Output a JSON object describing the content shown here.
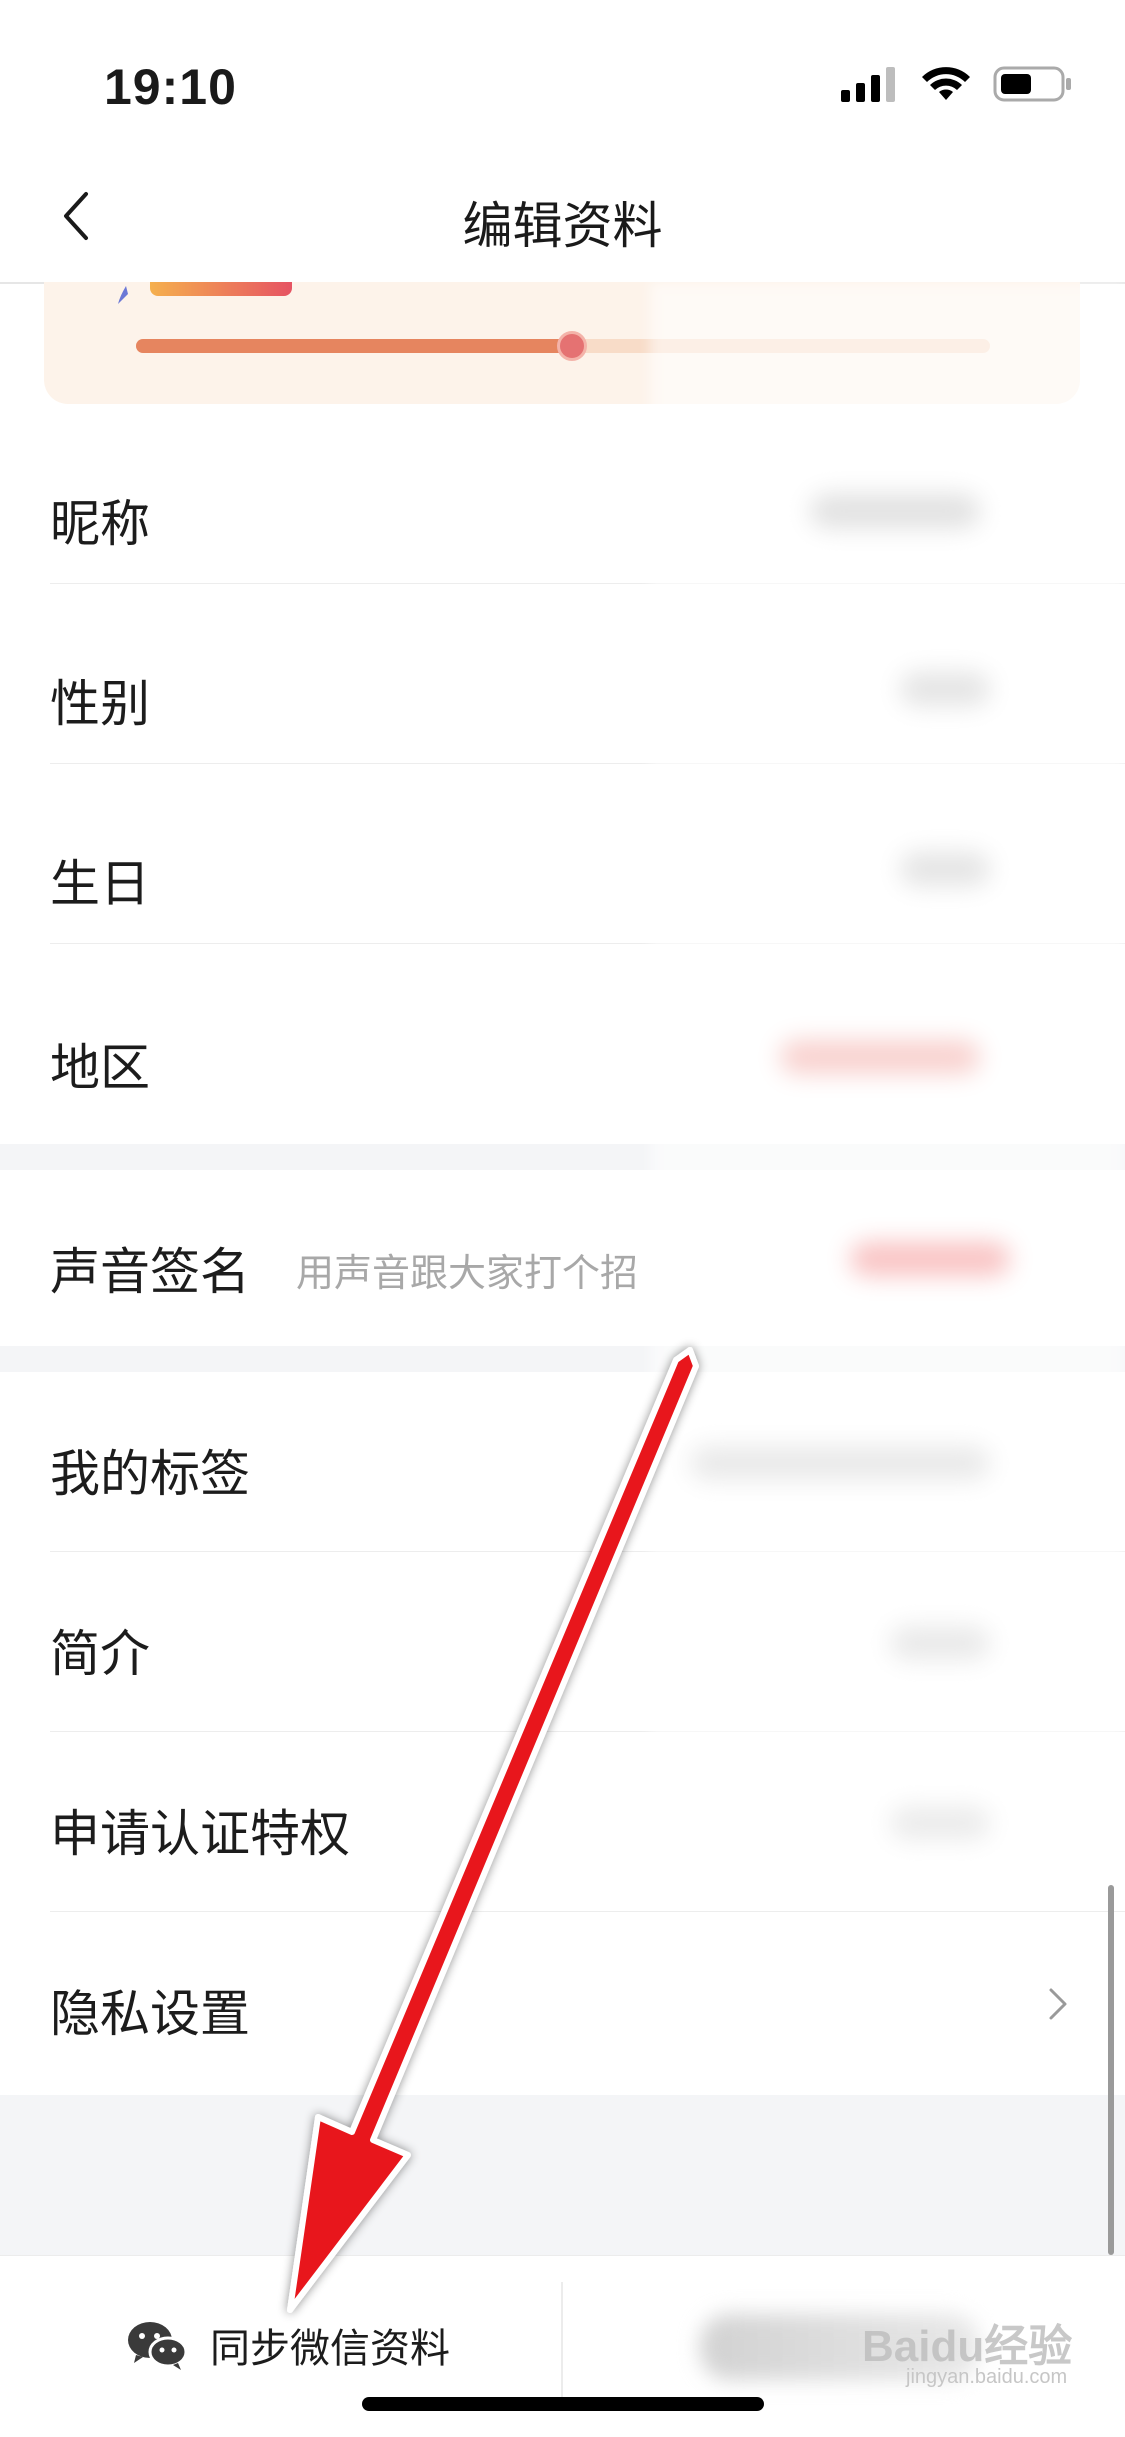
{
  "status": {
    "time": "19:10"
  },
  "nav": {
    "title": "编辑资料"
  },
  "profile": {
    "completion_fraction": 0.51
  },
  "rows": [
    {
      "label": "昵称"
    },
    {
      "label": "性别"
    },
    {
      "label": "生日"
    },
    {
      "label": "地区"
    }
  ],
  "voice": {
    "label": "声音签名",
    "placeholder": "用声音跟大家打个招"
  },
  "rows2": [
    {
      "label": "我的标签"
    },
    {
      "label": "简介"
    },
    {
      "label": "申请认证特权"
    },
    {
      "label": "隐私设置"
    }
  ],
  "bottom": {
    "sync_label": "同步微信资料"
  },
  "watermark": {
    "text": "Baidu经验",
    "sub": "jingyan.baidu.com"
  },
  "colors": {
    "accent": "#e6855f",
    "arrow": "#e8141a",
    "card_bg": "#fdf3ea"
  }
}
